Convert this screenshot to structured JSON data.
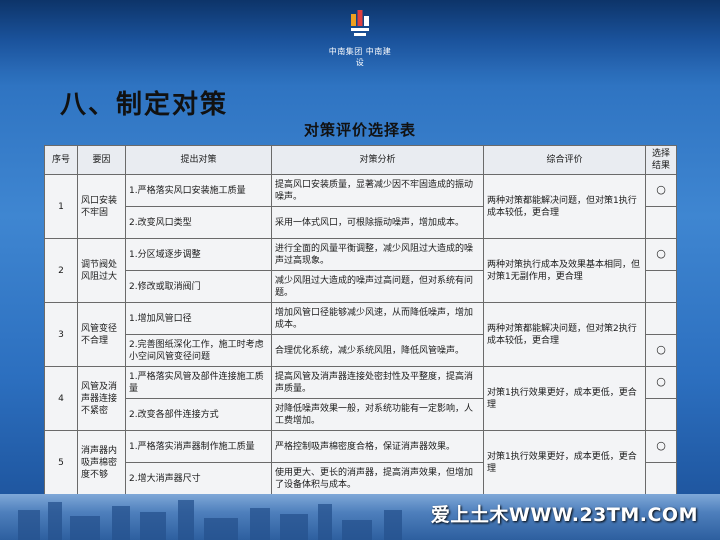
{
  "logo": {
    "text": "中南集团 中南建设"
  },
  "slide_title": "八、制定对策",
  "table_title": "对策评价选择表",
  "columns": [
    "序号",
    "要因",
    "提出对策",
    "对策分析",
    "综合评价",
    "选择结果"
  ],
  "rows": [
    {
      "no": "1",
      "cause": "风口安装不牢固",
      "measure": "1.严格落实风口安装施工质量",
      "analysis": "提高风口安装质量，显著减少因不牢固造成的振动噪声。",
      "evaluation": "两种对策都能解决问题，但对策1执行成本较低，更合理",
      "selection": "○"
    },
    {
      "measure": "2.改变风口类型",
      "analysis": "采用一体式风口，可根除振动噪声，增加成本。",
      "selection": ""
    },
    {
      "no": "2",
      "cause": "调节阀处风阻过大",
      "measure": "1.分区域逐步调整",
      "analysis": "进行全面的风量平衡调整，减少风阻过大造成的噪声过高现象。",
      "evaluation": "两种对策执行成本及效果基本相同，但对策1无副作用，更合理",
      "selection": "○"
    },
    {
      "measure": "2.修改或取消阀门",
      "analysis": "减少风阻过大造成的噪声过高问题，但对系统有问题。",
      "selection": ""
    },
    {
      "no": "3",
      "cause": "风管变径不合理",
      "measure": "1.增加风管口径",
      "analysis": "增加风管口径能够减少风速，从而降低噪声，增加成本。",
      "evaluation": "两种对策都能解决问题，但对策2执行成本较低，更合理",
      "selection": ""
    },
    {
      "measure": "2.完善图纸深化工作，施工时考虑小空间风管变径问题",
      "analysis": "合理优化系统，减少系统风阻，降低风管噪声。",
      "selection": "○"
    },
    {
      "no": "4",
      "cause": "风管及消声器连接不紧密",
      "measure": "1.严格落实风管及部件连接施工质量",
      "analysis": "提高风管及消声器连接处密封性及平整度，提高消声质量。",
      "evaluation": "对策1执行效果更好，成本更低，更合理",
      "selection": "○"
    },
    {
      "measure": "2.改变各部件连接方式",
      "analysis": "对降低噪声效果一般，对系统功能有一定影响，人工费增加。",
      "selection": ""
    },
    {
      "no": "5",
      "cause": "消声器内吸声棉密度不够",
      "measure": "1.严格落实消声器制作施工质量",
      "analysis": "严格控制吸声棉密度合格，保证消声器效果。",
      "evaluation": "对策1执行效果更好，成本更低，更合理",
      "selection": "○"
    },
    {
      "measure": "2.增大消声器尺寸",
      "analysis": "使用更大、更长的消声器，提高消声效果，但增加了设备体积与成本。",
      "selection": ""
    }
  ],
  "watermark": "爱上土木WWW.23TM.COM",
  "colors": {
    "background": "#3f86d1",
    "table_bg": "#f3f4f6",
    "border": "#6a6a6a",
    "title": "#111111"
  }
}
